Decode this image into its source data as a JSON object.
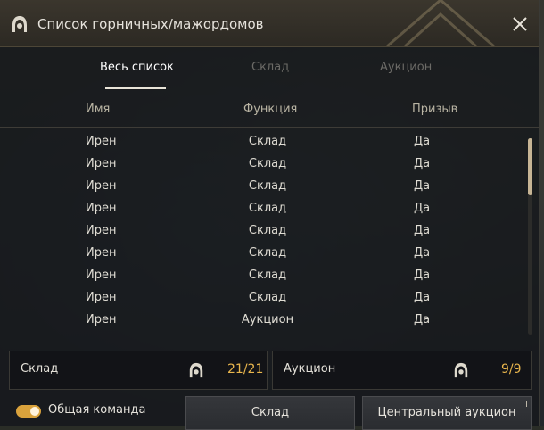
{
  "window": {
    "title": "Список горничных/мажордомов"
  },
  "tabs": [
    {
      "label": "Весь список",
      "active": true
    },
    {
      "label": "Склад",
      "active": false
    },
    {
      "label": "Аукцион",
      "active": false
    }
  ],
  "table": {
    "headers": {
      "name": "Имя",
      "function": "Функция",
      "summon": "Призыв"
    },
    "rows": [
      {
        "name": "Ирен",
        "function": "Склад",
        "summon": "Да"
      },
      {
        "name": "Ирен",
        "function": "Склад",
        "summon": "Да"
      },
      {
        "name": "Ирен",
        "function": "Склад",
        "summon": "Да"
      },
      {
        "name": "Ирен",
        "function": "Склад",
        "summon": "Да"
      },
      {
        "name": "Ирен",
        "function": "Склад",
        "summon": "Да"
      },
      {
        "name": "Ирен",
        "function": "Склад",
        "summon": "Да"
      },
      {
        "name": "Ирен",
        "function": "Склад",
        "summon": "Да"
      },
      {
        "name": "Ирен",
        "function": "Склад",
        "summon": "Да"
      },
      {
        "name": "Ирен",
        "function": "Аукцион",
        "summon": "Да"
      }
    ]
  },
  "counters": {
    "warehouse": {
      "label": "Склад",
      "value": "21/21"
    },
    "auction": {
      "label": "Аукцион",
      "value": "9/9"
    }
  },
  "footer": {
    "toggle_label": "Общая команда",
    "toggle_on": true,
    "warehouse_button": "Склад",
    "auction_button": "Центральный аукцион"
  },
  "colors": {
    "accent": "#e9b64d",
    "toggle": "#d9a23c"
  }
}
